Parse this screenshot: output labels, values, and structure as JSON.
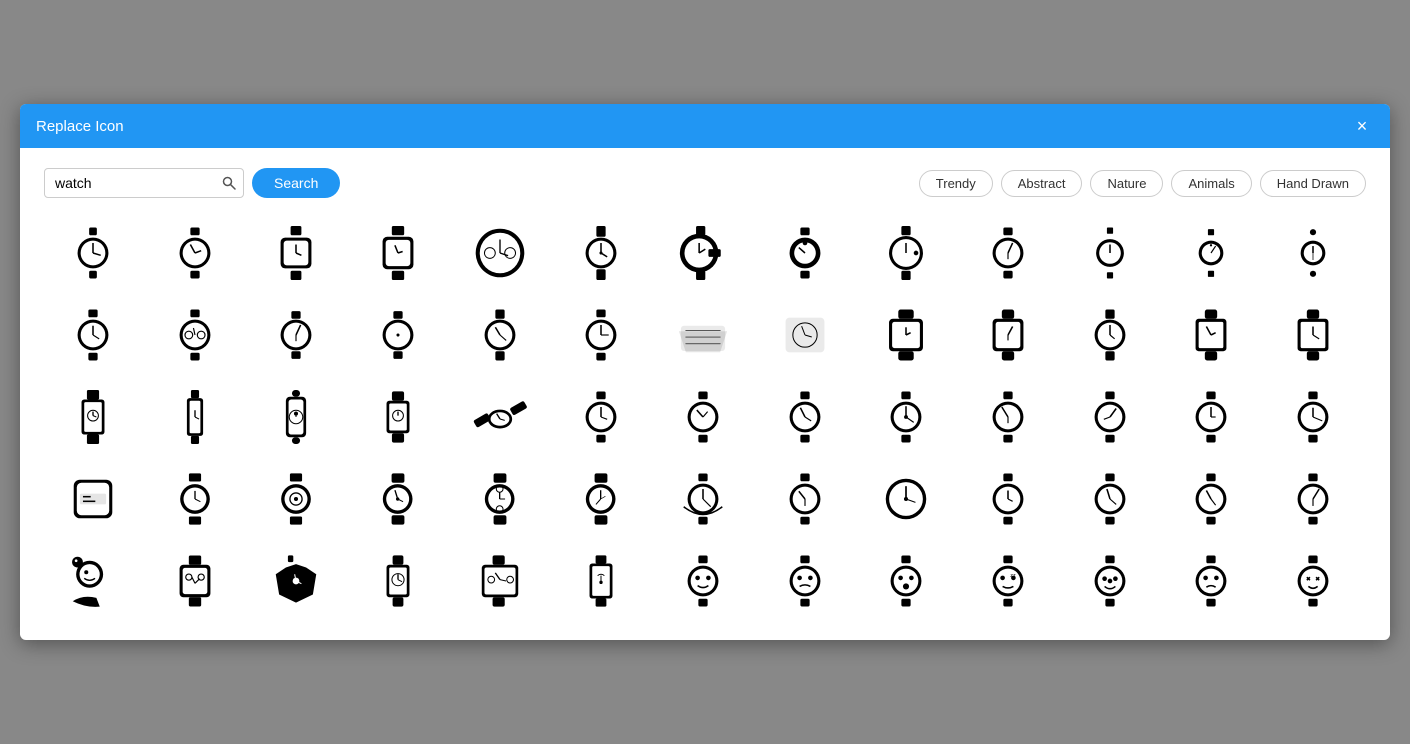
{
  "modal": {
    "title": "Replace Icon",
    "close_label": "×"
  },
  "search": {
    "value": "watch",
    "placeholder": "watch",
    "button_label": "Search"
  },
  "filters": [
    {
      "label": "Trendy",
      "id": "trendy"
    },
    {
      "label": "Abstract",
      "id": "abstract"
    },
    {
      "label": "Nature",
      "id": "nature"
    },
    {
      "label": "Animals",
      "id": "animals"
    },
    {
      "label": "Hand Drawn",
      "id": "hand-drawn"
    }
  ],
  "icons": {
    "count": 65
  }
}
